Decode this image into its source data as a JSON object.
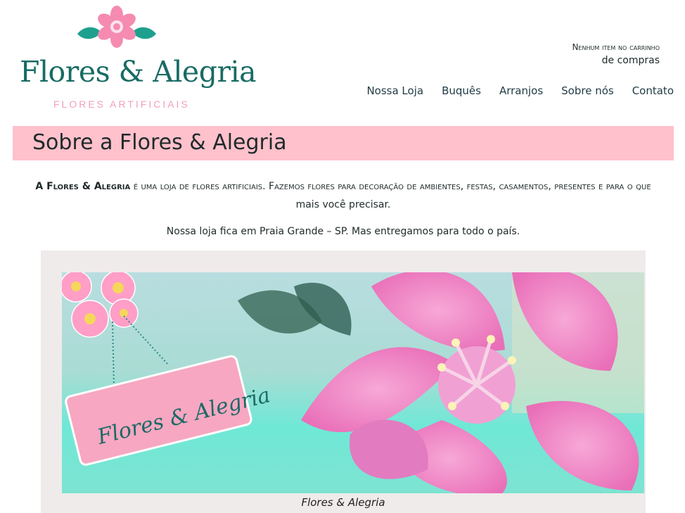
{
  "brand": {
    "name": "Flores & Alegria",
    "tagline": "FLORES ARTIFICIAIS"
  },
  "cart": {
    "line1": "Nenhum item no carrinho",
    "line2": "de compras"
  },
  "nav": {
    "items": [
      {
        "label": "Nossa Loja"
      },
      {
        "label": "Buquês"
      },
      {
        "label": "Arranjos"
      },
      {
        "label": "Sobre nós"
      },
      {
        "label": "Contato"
      }
    ]
  },
  "page": {
    "title": "Sobre a Flores & Alegria",
    "p1_strong": "A Flores & Alegria",
    "p1_rest": " é uma loja de flores artificiais. Fazemos flores para decoração de ambientes, festas, casamentos, presentes e para o que",
    "p1_line2": "mais você precisar.",
    "p2": "Nossa loja fica em Praia Grande – SP. Mas entregamos para todo o país."
  },
  "figure": {
    "sign_text": "Flores & Alegria",
    "caption": "Flores & Alegria"
  },
  "colors": {
    "brand_teal": "#186b63",
    "brand_pink": "#f2a0b8",
    "banner_pink": "#ffc1cc",
    "figure_bg": "#efebea"
  },
  "icons": {
    "logo_flower": "pink-flower-with-leaves"
  }
}
